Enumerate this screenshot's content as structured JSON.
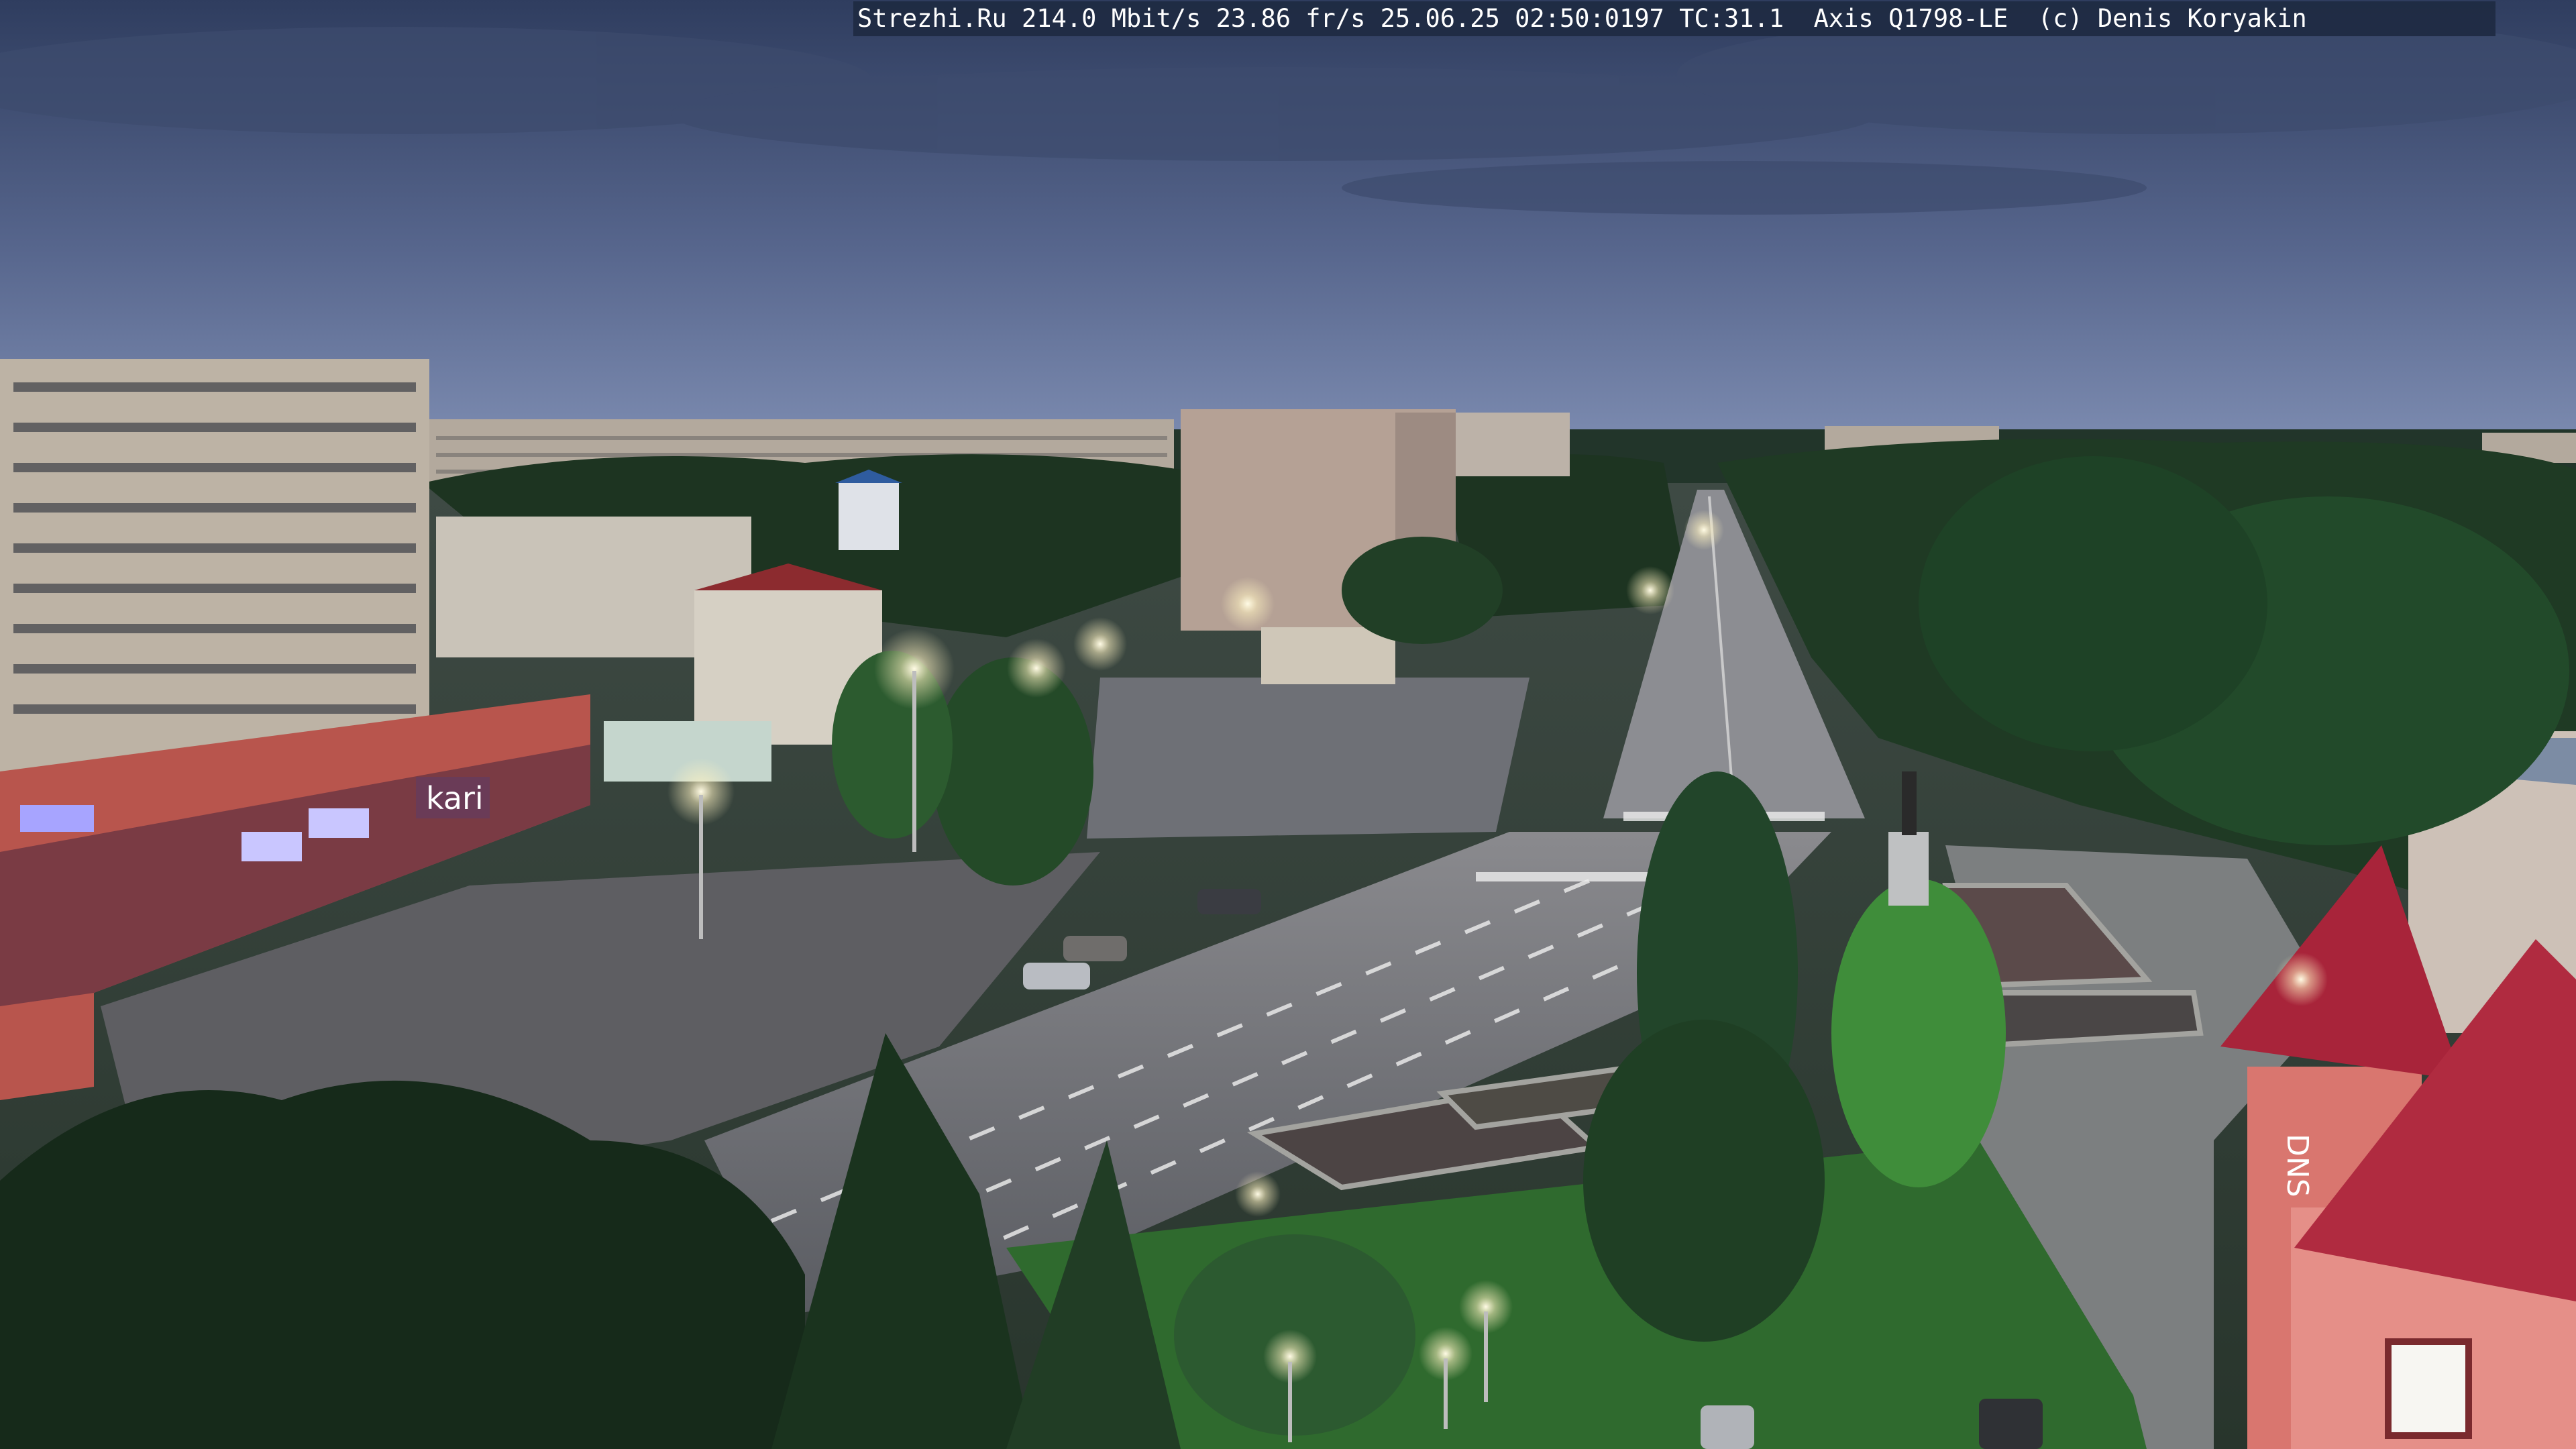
{
  "overlay": {
    "text": "Strezhi.Ru 214.0 Mbit/s 23.86 fr/s 25.06.25 02:50:0197 TC:31.1  Axis Q1798-LE  (c) Denis Koryakin"
  },
  "signs": {
    "store_sign": "kari",
    "tower_sign": "DNS"
  },
  "colors": {
    "sky_top": "#3a4a6e",
    "sky_horizon": "#6f7fa6",
    "asphalt": "#5f6166",
    "foliage": "#1f3a22",
    "lamp_glow": "#fff6d2",
    "brick_red": "#c0504a",
    "roof_red": "#a8243a"
  }
}
